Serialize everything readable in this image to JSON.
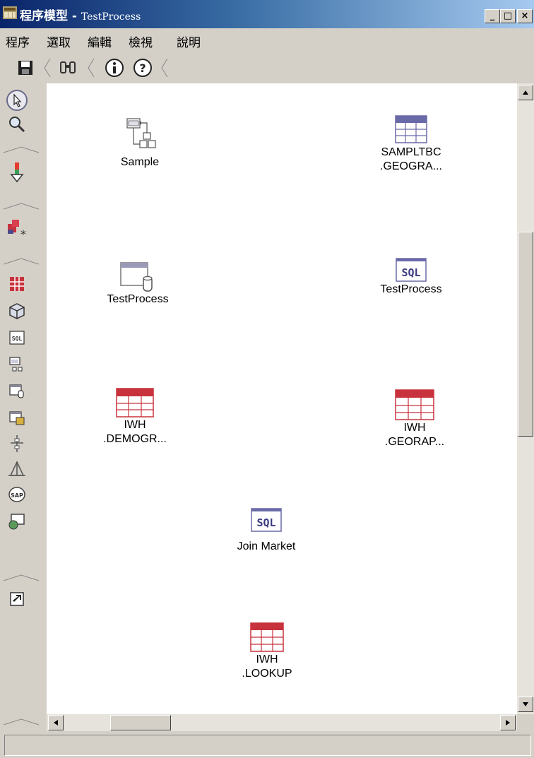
{
  "window": {
    "title_main": "程序模型 - ",
    "title_process": "TestProcess",
    "minimize": "_",
    "maximize": "□",
    "close": "×"
  },
  "menu": [
    "程序",
    "選取",
    "編輯",
    "檢視",
    "說明"
  ],
  "toolbar": {
    "icons": [
      "save-icon",
      "binoculars-icon",
      "info-icon",
      "help-icon"
    ]
  },
  "palette": {
    "icons": [
      "pointer-icon",
      "zoom-icon",
      "data-flow-arrow-icon",
      "shapes-star-icon",
      "table-grid-icon",
      "cube-icon",
      "sql-icon",
      "program-icon",
      "file-source-icon",
      "table-source-icon",
      "splitter-icon",
      "transformer-icon",
      "sap-icon",
      "web-service-icon",
      "shortcut-icon"
    ],
    "sql_text": "SQL",
    "sap_text": "SAP"
  },
  "nodes": {
    "sample": "Sample",
    "sampltbc": "SAMPLTBC\n.GEOGRA...",
    "testprocess_file": "TestProcess",
    "testprocess_sql": "TestProcess",
    "iwh_demogr": "IWH\n.DEMOGR...",
    "iwh_georap": "IWH\n.GEORAP...",
    "join_market": "Join Market",
    "iwh_lookup": "IWH\n.LOOKUP",
    "sql_badge": "SQL"
  },
  "colors": {
    "title_start": "#0a246a",
    "title_end": "#a6caf0",
    "target_table": "#c8323c",
    "source_table": "#6a6aa8"
  }
}
